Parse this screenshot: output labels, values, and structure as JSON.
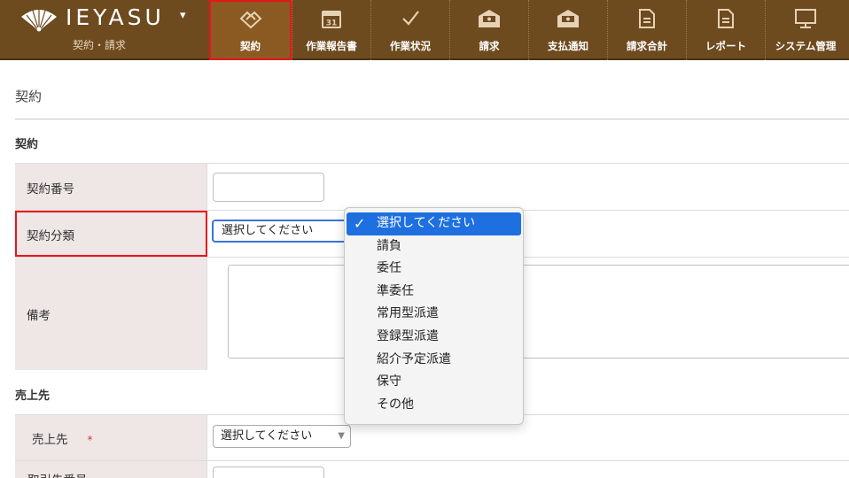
{
  "header": {
    "brand_name": "IEYASU",
    "brand_caret": "▾",
    "brand_subtitle": "契約・請求",
    "nav": [
      {
        "label": "契約",
        "icon": "handshake-icon",
        "active": true
      },
      {
        "label": "作業報告書",
        "icon": "calendar-icon",
        "active": false
      },
      {
        "label": "作業状況",
        "icon": "checkmark-icon",
        "active": false
      },
      {
        "label": "請求",
        "icon": "envelope-money-icon",
        "active": false
      },
      {
        "label": "支払通知",
        "icon": "envelope-money-icon",
        "active": false
      },
      {
        "label": "請求合計",
        "icon": "document-icon",
        "active": false
      },
      {
        "label": "レポート",
        "icon": "document-icon",
        "active": false
      },
      {
        "label": "システム管理",
        "icon": "monitor-icon",
        "active": false
      }
    ]
  },
  "page": {
    "title": "契約"
  },
  "contract_section": {
    "heading": "契約",
    "number_label": "契約番号",
    "number_value": "",
    "category_label": "契約分類",
    "category_selected": "選択してください",
    "category_arrow": "⌄",
    "notes_label": "備考",
    "notes_value": ""
  },
  "category_dropdown": {
    "check_mark": "✓",
    "options": [
      "選択してください",
      "請負",
      "委任",
      "準委任",
      "常用型派遣",
      "登録型派遣",
      "紹介予定派遣",
      "保守",
      "その他"
    ],
    "selected_index": 0
  },
  "sales_section": {
    "heading": "売上先",
    "customer_label": "売上先",
    "required_mark": "*",
    "customer_selected": "選択してください",
    "customer_arrow": "▼",
    "client_number_label": "取引先番号"
  },
  "colors": {
    "topbar": "#6e4a1f",
    "active_nav": "#8a5a22",
    "highlight_outline": "#e8141c",
    "label_cell": "#efe6e6",
    "dropdown_selected": "#1e6fe0"
  }
}
